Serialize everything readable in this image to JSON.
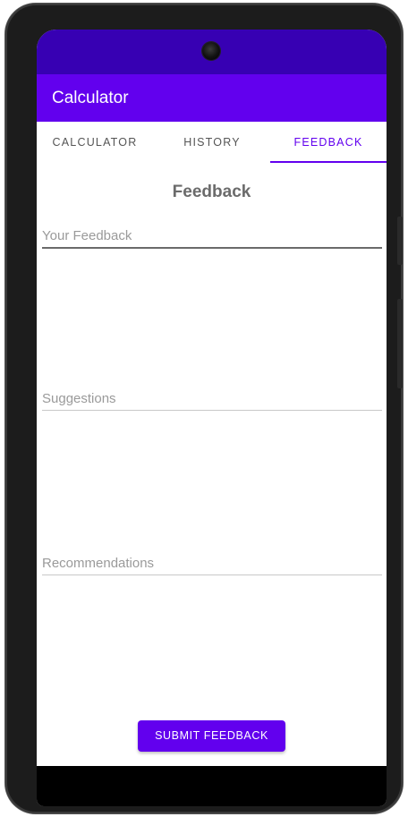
{
  "app_bar": {
    "title": "Calculator"
  },
  "tabs": [
    {
      "label": "CALCULATOR",
      "active": false
    },
    {
      "label": "HISTORY",
      "active": false
    },
    {
      "label": "FEEDBACK",
      "active": true
    }
  ],
  "content": {
    "title": "Feedback"
  },
  "fields": {
    "feedback": {
      "placeholder": "Your Feedback",
      "value": ""
    },
    "suggestions": {
      "placeholder": "Suggestions",
      "value": ""
    },
    "recommendations": {
      "placeholder": "Recommendations",
      "value": ""
    }
  },
  "actions": {
    "submit_label": "SUBMIT FEEDBACK"
  },
  "colors": {
    "primary": "#6200ee",
    "primary_dark": "#3700b3",
    "hint_text": "#9a9a9a",
    "tab_text": "#555555"
  }
}
